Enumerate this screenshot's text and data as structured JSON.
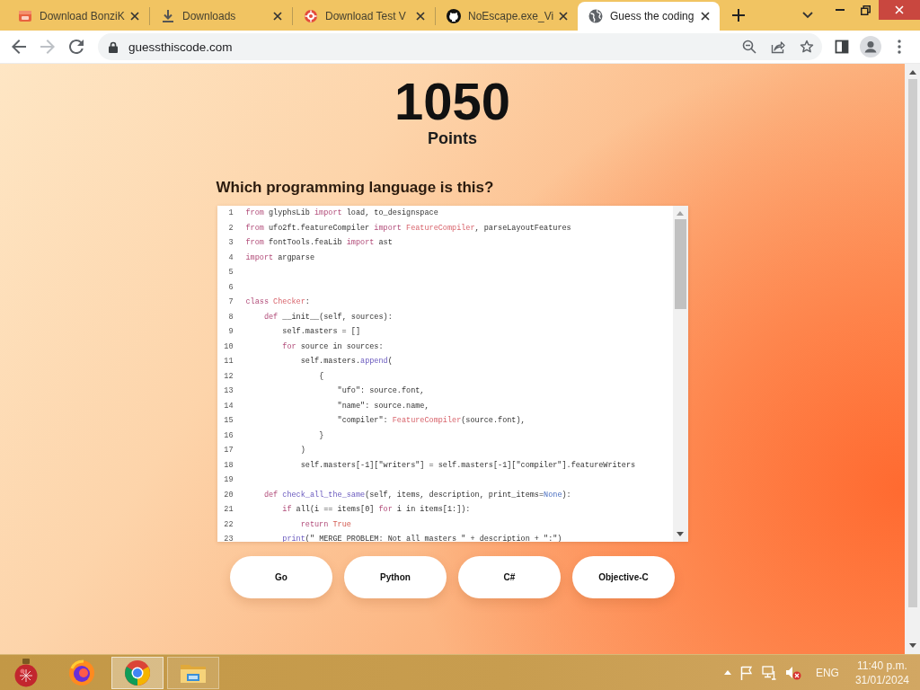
{
  "browser": {
    "tabs": [
      {
        "title": "Download BonziK",
        "kind": "store",
        "selected": false
      },
      {
        "title": "Downloads",
        "kind": "download",
        "selected": false
      },
      {
        "title": "Download Test V",
        "kind": "target",
        "selected": false
      },
      {
        "title": "NoEscape.exe_Vi",
        "kind": "cat",
        "selected": false
      },
      {
        "title": "Guess the coding",
        "kind": "globe",
        "selected": true
      }
    ],
    "nav_buttons": [
      {
        "kind": "back",
        "disabled": false
      },
      {
        "kind": "forward",
        "disabled": true
      },
      {
        "kind": "reload",
        "disabled": false
      }
    ],
    "address_bar": {
      "url": "guessthiscode.com"
    }
  },
  "page": {
    "score": "1050",
    "score_label": "Points",
    "question": "Which programming language is this?",
    "code": {
      "lines": [
        {
          "number": "1",
          "tokens": [
            {
              "text": "from",
              "kind": "keyword"
            },
            {
              "text": " glyphsLib ",
              "kind": "plain"
            },
            {
              "text": "import",
              "kind": "keyword"
            },
            {
              "text": " load, to_designspace",
              "kind": "plain"
            }
          ]
        },
        {
          "number": "2",
          "tokens": [
            {
              "text": "from",
              "kind": "keyword"
            },
            {
              "text": " ufo2ft.featureCompiler ",
              "kind": "plain"
            },
            {
              "text": "import",
              "kind": "keyword"
            },
            {
              "text": " FeatureCompiler",
              "kind": "type"
            },
            {
              "text": ", parseLayoutFeatures",
              "kind": "plain"
            }
          ]
        },
        {
          "number": "3",
          "tokens": [
            {
              "text": "from",
              "kind": "keyword"
            },
            {
              "text": " fontTools.feaLib ",
              "kind": "plain"
            },
            {
              "text": "import",
              "kind": "keyword"
            },
            {
              "text": " ast",
              "kind": "plain"
            }
          ]
        },
        {
          "number": "4",
          "tokens": [
            {
              "text": "import",
              "kind": "keyword"
            },
            {
              "text": " argparse",
              "kind": "plain"
            }
          ]
        },
        {
          "number": "5"
        },
        {
          "number": "6"
        },
        {
          "number": "7",
          "tokens": [
            {
              "text": "class",
              "kind": "keyword"
            },
            {
              "text": " Checker",
              "kind": "type"
            },
            {
              "text": ":",
              "kind": "plain"
            }
          ]
        },
        {
          "number": "8",
          "tokens": [
            {
              "text": "    def",
              "kind": "keyword"
            },
            {
              "text": " __init__(self, sources):",
              "kind": "plain"
            }
          ]
        },
        {
          "number": "9",
          "tokens": [
            {
              "text": "        self.masters = []",
              "kind": "plain"
            }
          ]
        },
        {
          "number": "10",
          "tokens": [
            {
              "text": "        for",
              "kind": "keyword"
            },
            {
              "text": " source in sources:",
              "kind": "plain"
            }
          ]
        },
        {
          "number": "11",
          "tokens": [
            {
              "text": "            self.masters.",
              "kind": "plain"
            },
            {
              "text": "append",
              "kind": "call"
            },
            {
              "text": "(",
              "kind": "plain"
            }
          ]
        },
        {
          "number": "12",
          "tokens": [
            {
              "text": "                {",
              "kind": "plain"
            }
          ]
        },
        {
          "number": "13",
          "tokens": [
            {
              "text": "                    \"ufo\": source.font,",
              "kind": "plain"
            }
          ]
        },
        {
          "number": "14",
          "tokens": [
            {
              "text": "                    \"name\": source.name,",
              "kind": "plain"
            }
          ]
        },
        {
          "number": "15",
          "tokens": [
            {
              "text": "                    \"compiler\": ",
              "kind": "plain"
            },
            {
              "text": "FeatureCompiler",
              "kind": "type"
            },
            {
              "text": "(source.font),",
              "kind": "plain"
            }
          ]
        },
        {
          "number": "16",
          "tokens": [
            {
              "text": "                }",
              "kind": "plain"
            }
          ]
        },
        {
          "number": "17",
          "tokens": [
            {
              "text": "            )",
              "kind": "plain"
            }
          ]
        },
        {
          "number": "18",
          "tokens": [
            {
              "text": "            self.masters[-1][\"writers\"] = self.masters[-1][\"compiler\"].featureWriters",
              "kind": "plain"
            }
          ]
        },
        {
          "number": "19"
        },
        {
          "number": "20",
          "tokens": [
            {
              "text": "    def",
              "kind": "keyword"
            },
            {
              "text": " check_all_the_same",
              "kind": "call"
            },
            {
              "text": "(self, items, description, print_items=",
              "kind": "plain"
            },
            {
              "text": "None",
              "kind": "builtin"
            },
            {
              "text": "):",
              "kind": "plain"
            }
          ]
        },
        {
          "number": "21",
          "tokens": [
            {
              "text": "        if",
              "kind": "keyword"
            },
            {
              "text": " all(i == items[0] ",
              "kind": "plain"
            },
            {
              "text": "for",
              "kind": "keyword"
            },
            {
              "text": " i in items[1:]):",
              "kind": "plain"
            }
          ]
        },
        {
          "number": "22",
          "tokens": [
            {
              "text": "            return",
              "kind": "keyword"
            },
            {
              "text": " True",
              "kind": "constant"
            }
          ]
        },
        {
          "number": "23",
          "tokens": [
            {
              "text": "        print",
              "kind": "call"
            },
            {
              "text": "(\" MERGE PROBLEM: Not all masters \" + description + \":\")",
              "kind": "plain"
            }
          ]
        }
      ]
    },
    "answers": [
      {
        "label": "Go"
      },
      {
        "label": "Python"
      },
      {
        "label": "C#"
      },
      {
        "label": "Objective-C"
      }
    ]
  },
  "taskbar": {
    "apps": [
      {
        "kind": "ornament",
        "selected": false,
        "running": false
      },
      {
        "kind": "firefox",
        "selected": false,
        "running": false
      },
      {
        "kind": "chrome",
        "selected": true,
        "running": true
      },
      {
        "kind": "explorer",
        "selected": false,
        "running": true
      }
    ],
    "tray": {
      "icons": [
        {
          "kind": "flag"
        },
        {
          "kind": "network"
        }
      ],
      "volume": {
        "muted": true
      },
      "language": "ENG",
      "time": "11:40 p.m.",
      "date": "31/01/2024"
    }
  }
}
